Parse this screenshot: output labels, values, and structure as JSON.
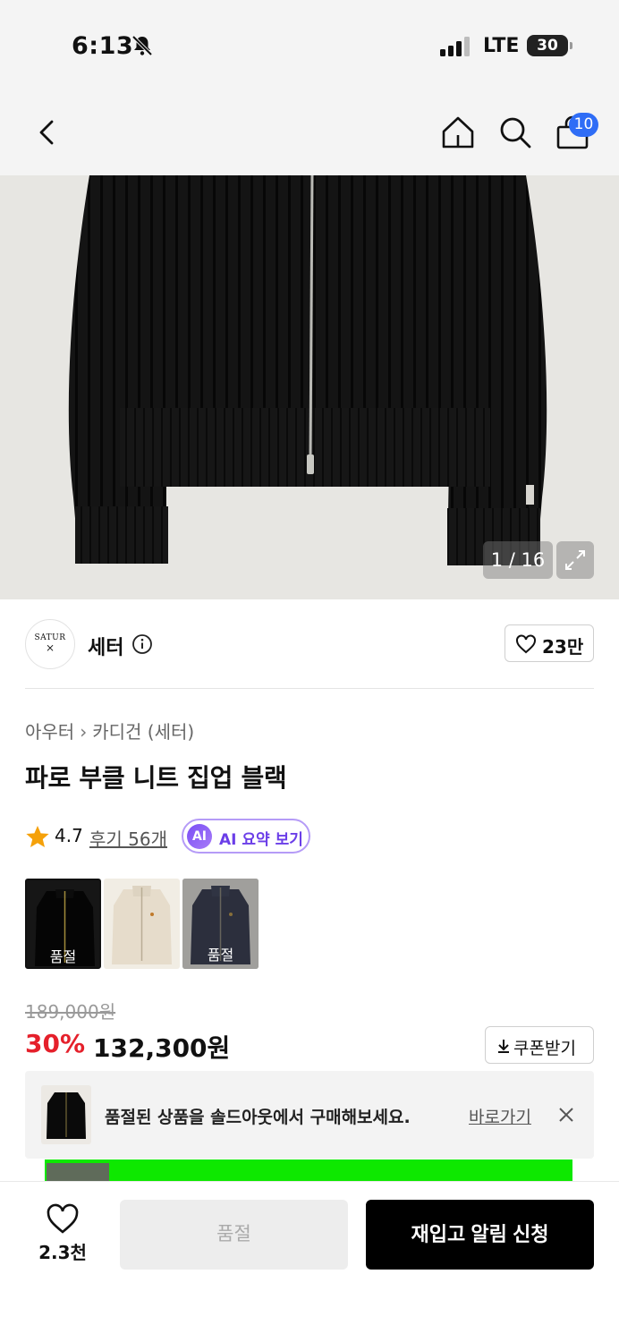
{
  "status_bar": {
    "time": "6:13",
    "network": "LTE",
    "battery": "30"
  },
  "header": {
    "icons": [
      "back-icon",
      "home-icon",
      "search-icon",
      "shopping-bag-icon"
    ],
    "cart_count": "10"
  },
  "gallery": {
    "counter": "1 / 16",
    "expand_icon": "expand-icon"
  },
  "brand": {
    "logo_text": "SATUR",
    "name": "세터",
    "likes": "23만"
  },
  "product": {
    "breadcrumb": [
      "아우터",
      "카디건 (세터)"
    ],
    "title": "파로 부클 니트 집업 블랙",
    "rating": "4.7",
    "reviews": "후기 56개",
    "ai_badge": "AI",
    "ai_summary": "AI 요약 보기"
  },
  "colors": [
    {
      "name": "black",
      "soldout": "품절"
    },
    {
      "name": "ivory",
      "soldout": ""
    },
    {
      "name": "navy",
      "soldout": "품절"
    }
  ],
  "price": {
    "original": "189,000원",
    "discount": "30%",
    "sale": "132,300원",
    "coupon": "쿠폰받기"
  },
  "soldout_banner": {
    "message": "품절된 상품을 솔드아웃에서 구매해보세요.",
    "link": "바로가기"
  },
  "bottom_bar": {
    "wish_count": "2.3천",
    "soldout_label": "품절",
    "restock_label": "재입고 알림 신청"
  },
  "colors_palette": {
    "accent_blue": "#2f6df6",
    "discount_red": "#e5202b",
    "ai_purple": "#6b3ee8",
    "promo_green": "#0ee800"
  }
}
